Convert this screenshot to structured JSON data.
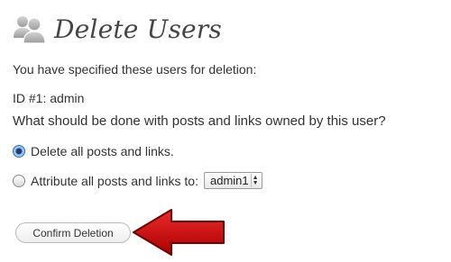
{
  "header": {
    "title": "Delete Users",
    "icon": "users-icon"
  },
  "body": {
    "intro": "You have specified these users for deletion:",
    "user_line": "ID #1: admin",
    "question": "What should be done with posts and links owned by this user?"
  },
  "options": [
    {
      "label": "Delete all posts and links.",
      "selected": true
    },
    {
      "label": "Attribute all posts and links to:",
      "selected": false
    }
  ],
  "attribute_select": {
    "value": "admin1"
  },
  "confirm_button": {
    "label": "Confirm Deletion"
  },
  "annotation": {
    "icon": "red-arrow-icon",
    "color": "#cc0000"
  }
}
